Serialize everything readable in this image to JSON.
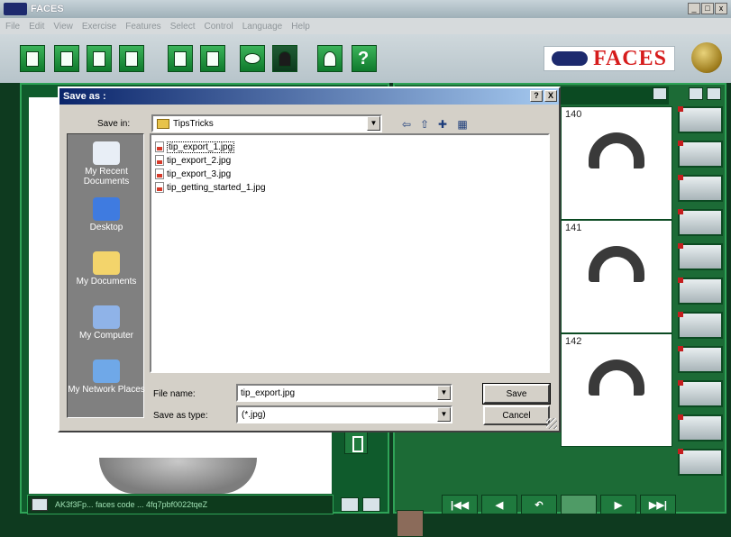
{
  "window": {
    "title": "FACES"
  },
  "menu": [
    "File",
    "Edit",
    "View",
    "Exercise",
    "Features",
    "Select",
    "Control",
    "Language",
    "Help"
  ],
  "brand": {
    "text": "FACES"
  },
  "status": {
    "code": "AK3f3Fp... faces code ... 4fq7pbf0022tqeZ"
  },
  "thumbnails": [
    {
      "number": "140"
    },
    {
      "number": "141"
    },
    {
      "number": "142"
    }
  ],
  "dialog": {
    "title": "Save as :",
    "help_btn": "?",
    "close_btn": "X",
    "save_in_label": "Save in:",
    "save_in_value": "TipsTricks",
    "places": [
      {
        "label": "My Recent Documents",
        "icon": "recent-documents-icon",
        "color": "#e8eef6"
      },
      {
        "label": "Desktop",
        "icon": "desktop-icon",
        "color": "#3f7be0"
      },
      {
        "label": "My Documents",
        "icon": "my-documents-icon",
        "color": "#f3d46b"
      },
      {
        "label": "My Computer",
        "icon": "my-computer-icon",
        "color": "#8fb3e8"
      },
      {
        "label": "My Network Places",
        "icon": "network-places-icon",
        "color": "#6fa8e8"
      }
    ],
    "files": [
      "tip_export_1.jpg",
      "tip_export_2.jpg",
      "tip_export_3.jpg",
      "tip_getting_started_1.jpg"
    ],
    "file_name_label": "File name:",
    "file_name_value": "tip_export.jpg",
    "save_type_label": "Save as type:",
    "save_type_value": "(*.jpg)",
    "save_button": "Save",
    "cancel_button": "Cancel"
  },
  "navigation": [
    "|◀◀",
    "◀",
    "↶",
    "",
    "▶",
    "▶▶|"
  ]
}
